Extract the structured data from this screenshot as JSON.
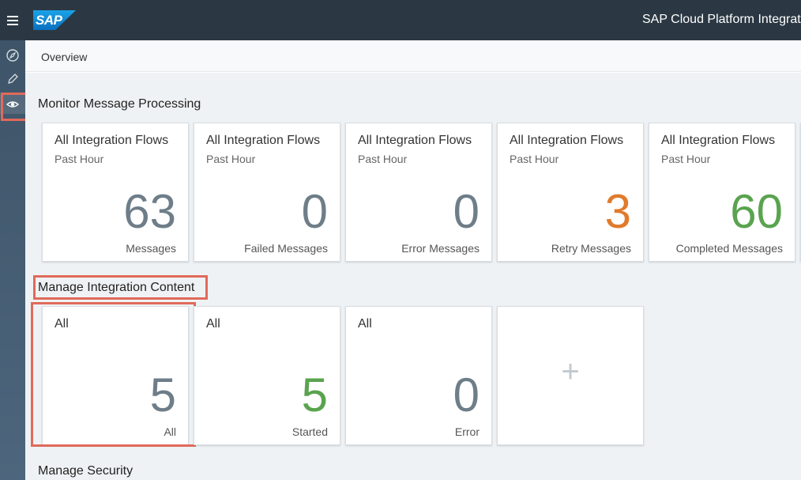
{
  "shell": {
    "logo_text": "SAP",
    "app_title": "SAP Cloud Platform Integrat"
  },
  "nav": {
    "items": [
      {
        "icon": "compass-icon"
      },
      {
        "icon": "pencil-icon"
      },
      {
        "icon": "eye-icon",
        "active": true
      }
    ]
  },
  "breadcrumb": "Overview",
  "monitor": {
    "title": "Monitor Message Processing",
    "tiles": [
      {
        "title": "All Integration Flows",
        "sub": "Past Hour",
        "value": "63",
        "unit": "Messages"
      },
      {
        "title": "All Integration Flows",
        "sub": "Past Hour",
        "value": "0",
        "unit": "Failed Messages"
      },
      {
        "title": "All Integration Flows",
        "sub": "Past Hour",
        "value": "0",
        "unit": "Error Messages"
      },
      {
        "title": "All Integration Flows",
        "sub": "Past Hour",
        "value": "3",
        "unit": "Retry Messages",
        "color": "#e07b2c"
      },
      {
        "title": "All Integration Flows",
        "sub": "Past Hour",
        "value": "60",
        "unit": "Completed Messages",
        "color": "#5aa34f"
      }
    ]
  },
  "manage_content": {
    "title": "Manage Integration Content",
    "tiles": [
      {
        "title": "All",
        "value": "5",
        "unit": "All"
      },
      {
        "title": "All",
        "value": "5",
        "unit": "Started",
        "color": "#5aa34f"
      },
      {
        "title": "All",
        "value": "0",
        "unit": "Error"
      }
    ],
    "add_tile_label": "+"
  },
  "manage_security": {
    "title": "Manage Security"
  },
  "colors": {
    "shell_bg": "#2b3843",
    "highlight": "#e06a5a",
    "orange": "#e07b2c",
    "green": "#5aa34f"
  }
}
